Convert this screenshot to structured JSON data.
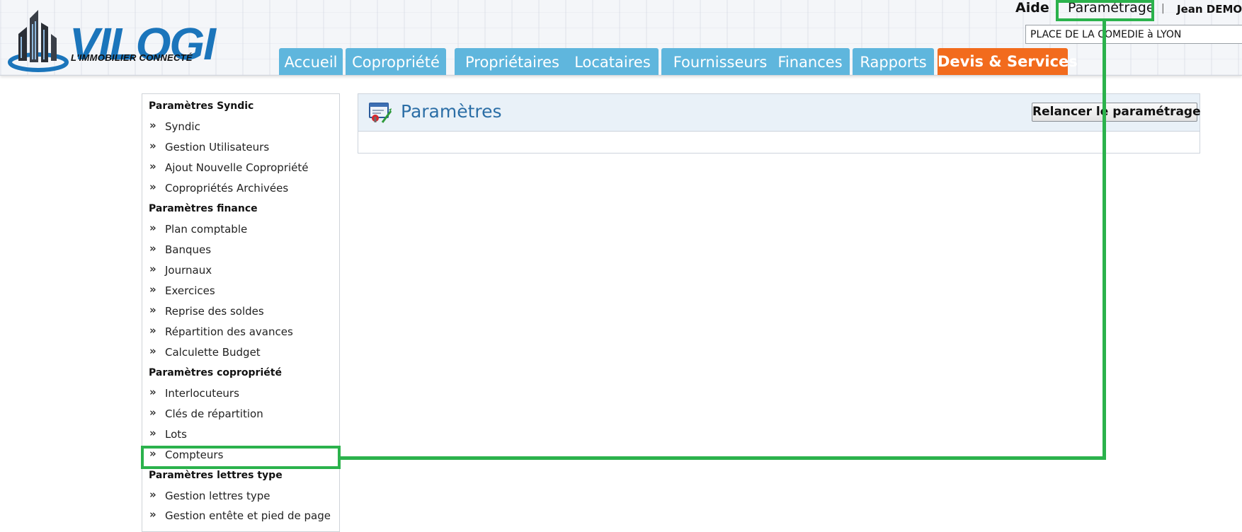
{
  "header": {
    "logo_text": "VILOGI",
    "logo_tagline": "L'IMMOBILIER CONNECTÉ",
    "links": {
      "aide": "Aide",
      "separator": "|",
      "parametrage": "Paramétrage",
      "user": "Jean DEMO"
    },
    "copropriete_value": "PLACE DE LA COMEDIE à LYON",
    "tabs": [
      {
        "label": "Accueil"
      },
      {
        "label": "Copropriété"
      },
      {
        "label": "Propriétaires"
      },
      {
        "label": "Locataires"
      },
      {
        "label": "Fournisseurs"
      },
      {
        "label": "Finances"
      },
      {
        "label": "Rapports"
      },
      {
        "label": "Devis & Services"
      }
    ]
  },
  "sidebar": {
    "chevron": "»",
    "sections": [
      {
        "title": "Paramètres Syndic",
        "items": [
          "Syndic",
          "Gestion Utilisateurs",
          "Ajout Nouvelle Copropriété",
          "Copropriétés Archivées"
        ]
      },
      {
        "title": "Paramètres finance",
        "items": [
          "Plan comptable",
          "Banques",
          "Journaux",
          "Exercices",
          "Reprise des soldes",
          "Répartition des avances",
          "Calculette Budget"
        ]
      },
      {
        "title": "Paramètres copropriété",
        "items": [
          "Interlocuteurs",
          "Clés de répartition",
          "Lots",
          "Compteurs"
        ]
      },
      {
        "title": "Paramètres lettres type",
        "items": [
          "Gestion lettres type",
          "Gestion entête et pied de page"
        ]
      }
    ]
  },
  "main": {
    "title": "Paramètres",
    "relaunch_button": "Relancer le paramétrage"
  },
  "colors": {
    "tab_blue": "#5fb6dd",
    "tab_orange": "#f26b1d",
    "title_blue": "#2b6ea6",
    "highlight_green": "#2bb24c"
  }
}
